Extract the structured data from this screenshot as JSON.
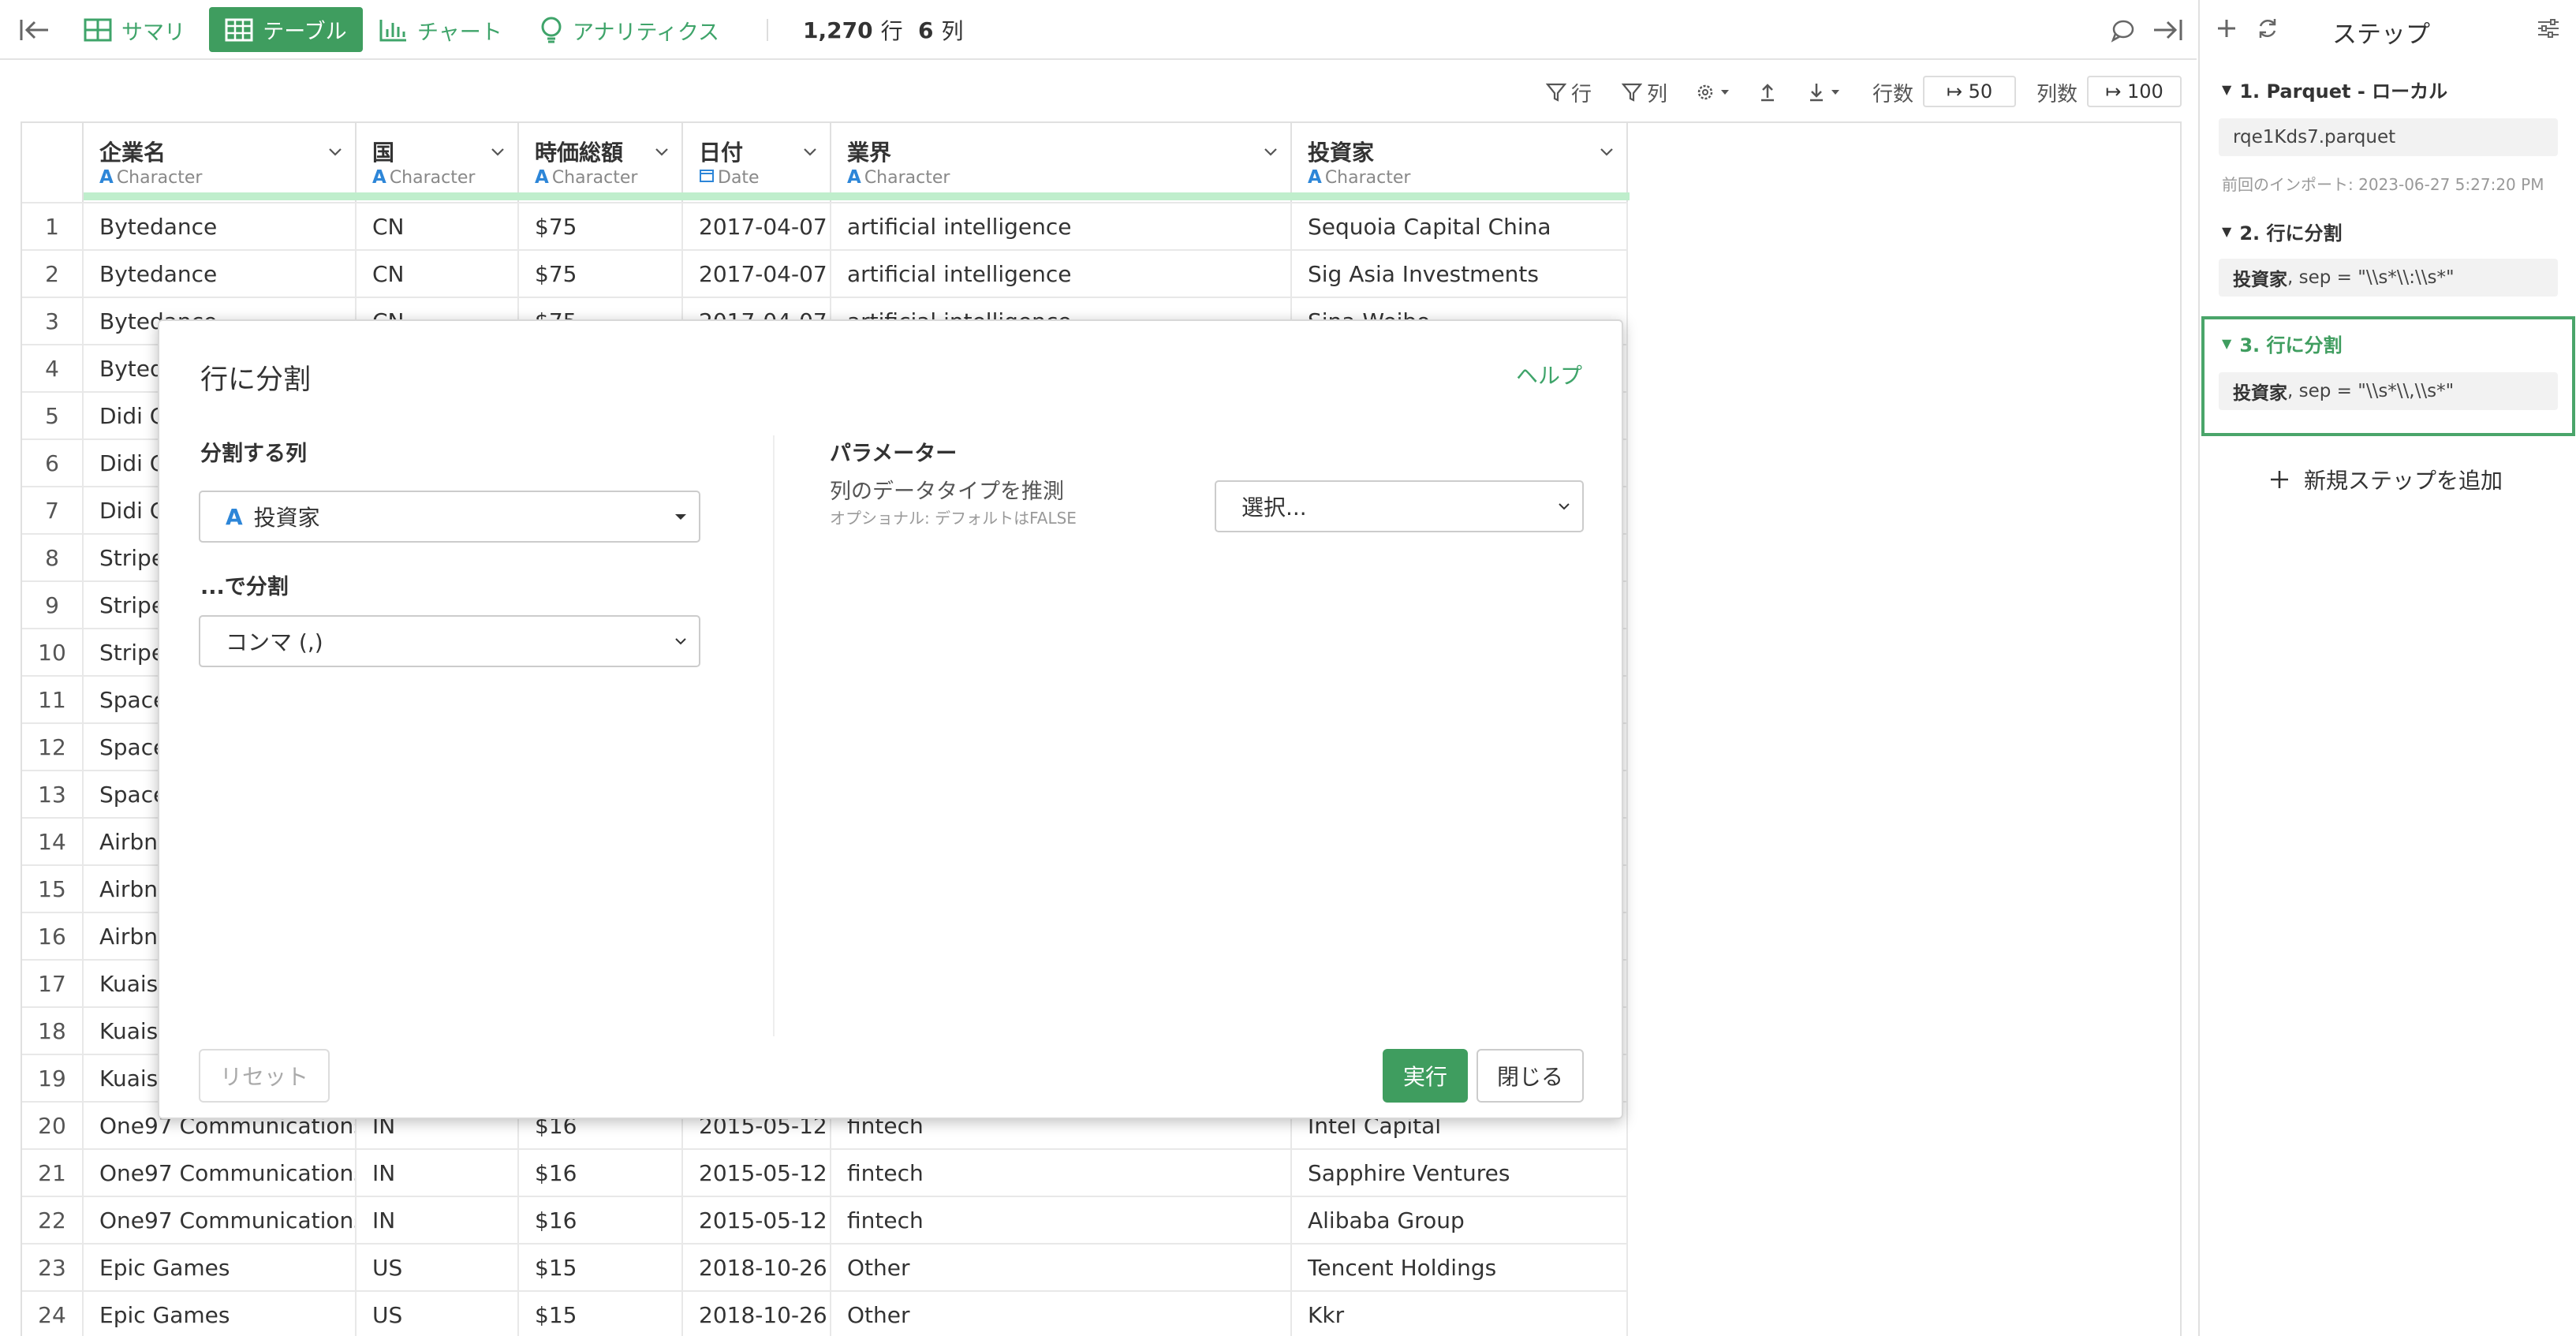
{
  "topbar": {
    "tabs": [
      {
        "label": "サマリ",
        "icon": "summary-icon"
      },
      {
        "label": "テーブル",
        "icon": "table-icon",
        "active": true
      },
      {
        "label": "チャート",
        "icon": "chart-icon"
      },
      {
        "label": "アナリティクス",
        "icon": "lightbulb-icon"
      }
    ],
    "rows_count": "1,270",
    "rows_unit": "行",
    "cols_count": "6",
    "cols_unit": "列"
  },
  "toolbar": {
    "row_filter": "行",
    "col_filter": "列",
    "rows_label": "行数",
    "rows_value": "50",
    "cols_label": "列数",
    "cols_value": "100"
  },
  "table": {
    "columns": [
      {
        "name": "企業名",
        "type": "Character"
      },
      {
        "name": "国",
        "type": "Character"
      },
      {
        "name": "時価総額",
        "type": "Character"
      },
      {
        "name": "日付",
        "type": "Date"
      },
      {
        "name": "業界",
        "type": "Character"
      },
      {
        "name": "投資家",
        "type": "Character"
      }
    ],
    "rows": [
      [
        "1",
        "Bytedance",
        "CN",
        "$75",
        "2017-04-07",
        "artificial intelligence",
        "Sequoia Capital China"
      ],
      [
        "2",
        "Bytedance",
        "CN",
        "$75",
        "2017-04-07",
        "artificial intelligence",
        "Sig Asia Investments"
      ],
      [
        "3",
        "Bytedance",
        "CN",
        "$75",
        "2017-04-07",
        "artificial intelligence",
        "Sina Weibo"
      ],
      [
        "4",
        "Bytedance",
        "",
        "",
        "",
        "",
        ""
      ],
      [
        "5",
        "Didi Chuxing",
        "",
        "",
        "",
        "",
        ""
      ],
      [
        "6",
        "Didi Chuxing",
        "",
        "",
        "",
        "",
        ""
      ],
      [
        "7",
        "Didi Chuxing",
        "",
        "",
        "",
        "",
        ""
      ],
      [
        "8",
        "Stripe",
        "",
        "",
        "",
        "",
        ""
      ],
      [
        "9",
        "Stripe",
        "",
        "",
        "",
        "",
        ""
      ],
      [
        "10",
        "Stripe",
        "",
        "",
        "",
        "",
        ""
      ],
      [
        "11",
        "SpaceX",
        "",
        "",
        "",
        "",
        ""
      ],
      [
        "12",
        "SpaceX",
        "",
        "",
        "",
        "",
        ""
      ],
      [
        "13",
        "SpaceX",
        "",
        "",
        "",
        "",
        ""
      ],
      [
        "14",
        "Airbnb",
        "",
        "",
        "",
        "",
        ""
      ],
      [
        "15",
        "Airbnb",
        "",
        "",
        "",
        "",
        ""
      ],
      [
        "16",
        "Airbnb",
        "",
        "",
        "",
        "",
        ""
      ],
      [
        "17",
        "Kuaishou",
        "",
        "",
        "",
        "",
        ""
      ],
      [
        "18",
        "Kuaishou",
        "",
        "",
        "",
        "",
        ""
      ],
      [
        "19",
        "Kuaishou",
        "",
        "",
        "",
        "",
        ""
      ],
      [
        "20",
        "One97 Communications",
        "IN",
        "$16",
        "2015-05-12",
        "fintech",
        "Intel Capital"
      ],
      [
        "21",
        "One97 Communications",
        "IN",
        "$16",
        "2015-05-12",
        "fintech",
        "Sapphire Ventures"
      ],
      [
        "22",
        "One97 Communications",
        "IN",
        "$16",
        "2015-05-12",
        "fintech",
        "Alibaba Group"
      ],
      [
        "23",
        "Epic Games",
        "US",
        "$15",
        "2018-10-26",
        "Other",
        "Tencent Holdings"
      ],
      [
        "24",
        "Epic Games",
        "US",
        "$15",
        "2018-10-26",
        "Other",
        "Kkr"
      ]
    ]
  },
  "steps_panel": {
    "title": "ステップ",
    "steps": [
      {
        "title": "1. Parquet - ローカル",
        "detail": "rqe1Kds7.parquet",
        "note": "前回のインポート: 2023-06-27 5:27:20 PM"
      },
      {
        "title": "2. 行に分割",
        "detail_bold": "投資家",
        "detail": ", sep = \"\\\\s*\\\\:\\\\s*\""
      },
      {
        "title": "3. 行に分割",
        "detail_bold": "投資家",
        "detail": ", sep = \"\\\\s*\\\\,\\\\s*\"",
        "selected": true
      }
    ],
    "add_step": "新規ステップを追加"
  },
  "dialog": {
    "title": "行に分割",
    "help": "ヘルプ",
    "column_label": "分割する列",
    "column_value": "投資家",
    "split_by_label": "...で分割",
    "split_by_value": "コンマ (,)",
    "params_label": "パラメーター",
    "infer_label": "列のデータタイプを推測",
    "infer_sub": "オプショナル: デフォルトはFALSE",
    "infer_value": "選択...",
    "reset": "リセット",
    "run": "実行",
    "close": "閉じる"
  },
  "colors": {
    "accent": "#3f9d5f",
    "type_icon": "#2d86d8",
    "highlight": "#bfeecc"
  }
}
